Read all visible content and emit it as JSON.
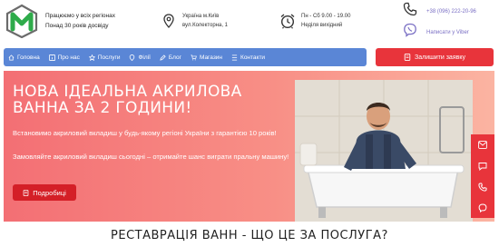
{
  "header": {
    "tagline_line1": "Працюємо у всіх регіонах",
    "tagline_line2": "Понад 30 років досвіду",
    "address_line1": "Україна м.Київ",
    "address_line2": "вул.Колекторна, 1",
    "hours_line1": "Пн - Сб 9.00 - 19.00",
    "hours_line2": "Неділя вихідний",
    "phone": "+38 (096) 222-20-96",
    "viber": "Написати у Viber"
  },
  "nav": {
    "items": [
      {
        "label": "Головна",
        "icon": "home-icon"
      },
      {
        "label": "Про нас",
        "icon": "info-icon"
      },
      {
        "label": "Послуги",
        "icon": "star-icon"
      },
      {
        "label": "Філії",
        "icon": "pin-icon"
      },
      {
        "label": "Блог",
        "icon": "pencil-icon"
      },
      {
        "label": "Магазин",
        "icon": "cart-icon"
      },
      {
        "label": "Контакти",
        "icon": "contacts-icon"
      }
    ],
    "cta_label": "Залишити заявку"
  },
  "hero": {
    "title": "НОВА ІДЕАЛЬНА АКРИЛОВА ВАННА ЗА 2 ГОДИНИ!",
    "subtitle": "Встановимо акриловий вкладиш у будь-якому регіоні України з гарантією 10 років!",
    "subtitle2": "Замовляйте акриловий вкладиш сьогодні – отримайте шанс виграти пральну машину!",
    "button_label": "Подробиці"
  },
  "section": {
    "title": "РЕСТАВРАЦІЯ ВАНН - ЩО ЦЕ ЗА ПОСЛУГА?"
  },
  "colors": {
    "nav_bg": "#5a86d6",
    "cta_red": "#e8343b",
    "hero_gradient_start": "#f36f74",
    "hero_gradient_end": "#fbb4a2",
    "logo_green": "#2eab4a"
  }
}
